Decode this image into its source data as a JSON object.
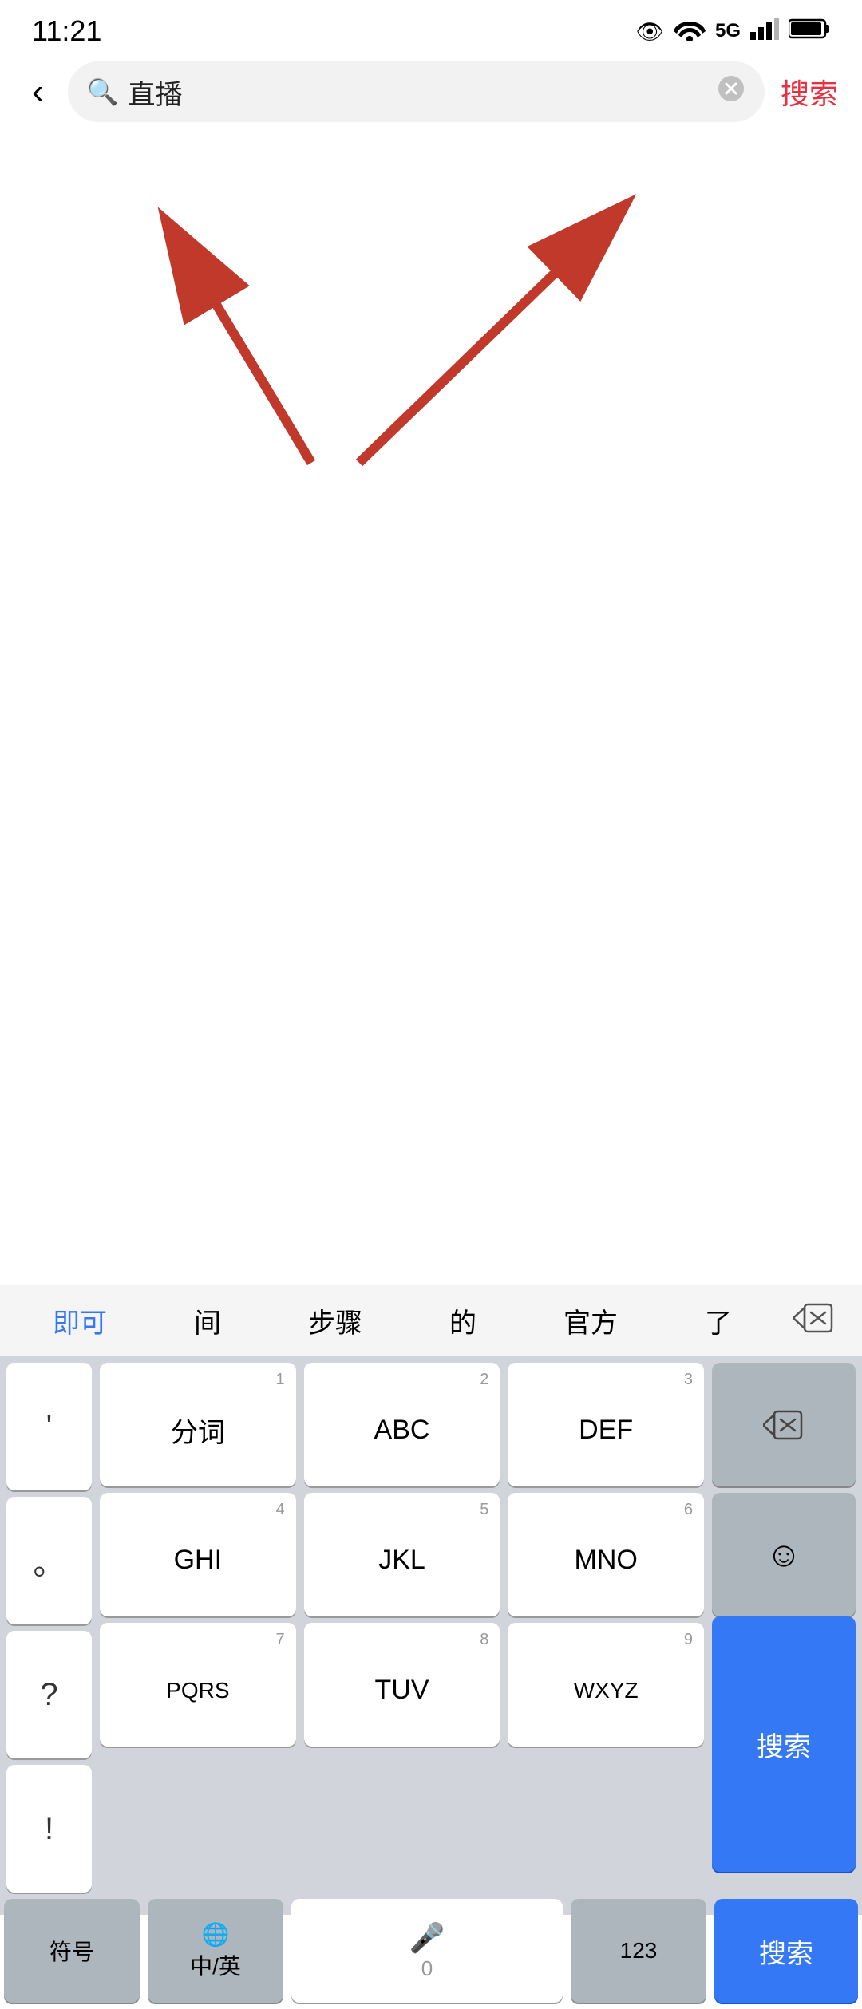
{
  "statusBar": {
    "time": "11:21"
  },
  "searchBar": {
    "backLabel": "‹",
    "placeholder": "直播",
    "clearIcon": "✕",
    "searchBtnLabel": "搜索"
  },
  "imeSuggestions": {
    "items": [
      "即可",
      "间",
      "步骤",
      "的",
      "官方",
      "了"
    ],
    "activeIndex": 0,
    "deleteIcon": "⊗"
  },
  "keyboard": {
    "leftCol": [
      "'",
      "。",
      "?",
      "!"
    ],
    "rows": [
      {
        "keys": [
          {
            "sub": "1",
            "label": "分词"
          },
          {
            "sub": "2",
            "label": "ABC"
          },
          {
            "sub": "3",
            "label": "DEF"
          }
        ],
        "rightSpecial": "⌫"
      },
      {
        "keys": [
          {
            "sub": "4",
            "label": "GHI"
          },
          {
            "sub": "5",
            "label": "JKL"
          },
          {
            "sub": "6",
            "label": "MNO"
          }
        ],
        "rightSpecial": "☺"
      },
      {
        "keys": [
          {
            "sub": "7",
            "label": "PQRS"
          },
          {
            "sub": "8",
            "label": "TUV"
          },
          {
            "sub": "9",
            "label": "WXYZ"
          }
        ],
        "rightSpecial": "搜索"
      }
    ],
    "bottomRow": {
      "symbolLabel": "符号",
      "langLabel": "中/英",
      "zeroLabel": "0",
      "numLabel": "123"
    }
  }
}
